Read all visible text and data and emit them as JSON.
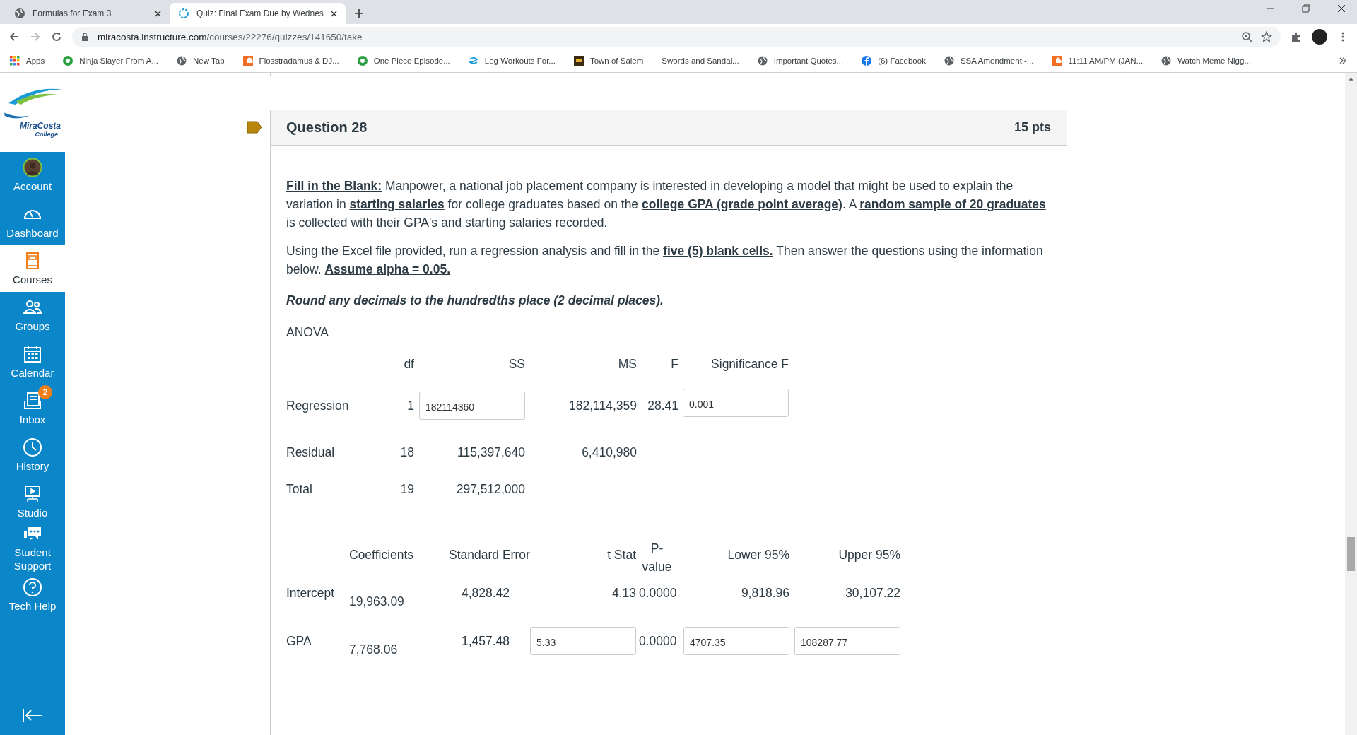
{
  "browser": {
    "tabs": [
      {
        "title": "Formulas for Exam 3",
        "selected": false,
        "kind": "globe"
      },
      {
        "title": "Quiz: Final Exam Due by Wednes",
        "selected": true,
        "kind": "spinner"
      }
    ],
    "url_host": "miracosta.instructure.com",
    "url_path": "/courses/22276/quizzes/141650/take",
    "bookmarks": [
      {
        "label": "Apps",
        "kind": "grid"
      },
      {
        "label": "Ninja Slayer From A...",
        "kind": "go"
      },
      {
        "label": "New Tab",
        "kind": "globe"
      },
      {
        "label": "Flosstradamus & DJ...",
        "kind": "wave"
      },
      {
        "label": "One Piece Episode...",
        "kind": "go"
      },
      {
        "label": "Leg Workouts For...",
        "kind": "swirl"
      },
      {
        "label": "Town of Salem",
        "kind": "tile"
      },
      {
        "label": "Swords and Sandal...",
        "kind": "none"
      },
      {
        "label": "Important Quotes...",
        "kind": "globe"
      },
      {
        "label": "(6) Facebook",
        "kind": "fb"
      },
      {
        "label": "SSA Amendment -...",
        "kind": "globe"
      },
      {
        "label": "11:11 AM/PM (JAN...",
        "kind": "wave"
      },
      {
        "label": "Watch Meme Nigg...",
        "kind": "globe"
      }
    ]
  },
  "logo": {
    "line1": "MiraCosta",
    "line2": "College"
  },
  "sidebar": {
    "items": [
      {
        "label": "Account",
        "kind": "avatar",
        "selected": false
      },
      {
        "label": "Dashboard",
        "kind": "gauge",
        "selected": false
      },
      {
        "label": "Courses",
        "kind": "book",
        "selected": true
      },
      {
        "label": "Groups",
        "kind": "people",
        "selected": false
      },
      {
        "label": "Calendar",
        "kind": "calendar",
        "selected": false
      },
      {
        "label": "Inbox",
        "kind": "inbox",
        "selected": false,
        "badge": "2"
      },
      {
        "label": "History",
        "kind": "clock",
        "selected": false
      },
      {
        "label": "Studio",
        "kind": "studio",
        "selected": false
      },
      {
        "label": "Student Support",
        "kind": "chat",
        "selected": false
      },
      {
        "label": "Tech Help",
        "kind": "help",
        "selected": false
      }
    ]
  },
  "question": {
    "title": "Question 28",
    "points": "15 pts",
    "paragraphs": [
      "**Fill in the Blank:** Manpower, a national job placement company is interested in developing a model that might be used to explain the variation in **starting salaries** for college graduates based on the **college GPA (grade point average)**. A **random sample of 20 graduates** is collected with their GPA's and starting salaries recorded.",
      "Using the Excel file provided, run a regression analysis and fill in the **five (5) blank cells.** Then answer the questions using the information below. **Assume alpha = 0.05.**"
    ],
    "instruction": "Round any decimals to the hundredths place (2 decimal places).",
    "anova": {
      "title": "ANOVA",
      "columns": [
        "df",
        "SS",
        "MS",
        "F",
        "Significance F"
      ],
      "rows": [
        {
          "label": "Regression",
          "cells": [
            {
              "kind": "text",
              "value": "1"
            },
            {
              "kind": "input",
              "value": "182114360"
            },
            {
              "kind": "text",
              "value": "182,114,359"
            },
            {
              "kind": "text",
              "value": "28.41"
            },
            {
              "kind": "input",
              "value": "0.001"
            }
          ]
        },
        {
          "label": "Residual",
          "cells": [
            {
              "kind": "text",
              "value": "18"
            },
            {
              "kind": "text",
              "value": "115,397,640"
            },
            {
              "kind": "text",
              "value": "6,410,980"
            }
          ]
        },
        {
          "label": "Total",
          "cells": [
            {
              "kind": "text",
              "value": "19"
            },
            {
              "kind": "text",
              "value": "297,512,000"
            }
          ]
        }
      ]
    },
    "coefficients": {
      "columns": [
        "Coefficients",
        "Standard Error",
        "t Stat",
        "P-value",
        "Lower 95%",
        "Upper 95%"
      ],
      "rows": [
        {
          "label": "Intercept",
          "cells": [
            {
              "kind": "text",
              "value": "19,963.09"
            },
            {
              "kind": "text",
              "value": "4,828.42"
            },
            {
              "kind": "text",
              "value": "4.13"
            },
            {
              "kind": "text",
              "value": "0.0000"
            },
            {
              "kind": "text",
              "value": "9,818.96"
            },
            {
              "kind": "text",
              "value": "30,107.22"
            }
          ]
        },
        {
          "label": "GPA",
          "cells": [
            {
              "kind": "text",
              "value": "7,768.06"
            },
            {
              "kind": "text",
              "value": "1,457.48"
            },
            {
              "kind": "input",
              "value": "5.33"
            },
            {
              "kind": "text",
              "value": "0.0000"
            },
            {
              "kind": "input",
              "value": "4707.35"
            },
            {
              "kind": "input",
              "value": "108287.77"
            }
          ]
        }
      ]
    }
  }
}
